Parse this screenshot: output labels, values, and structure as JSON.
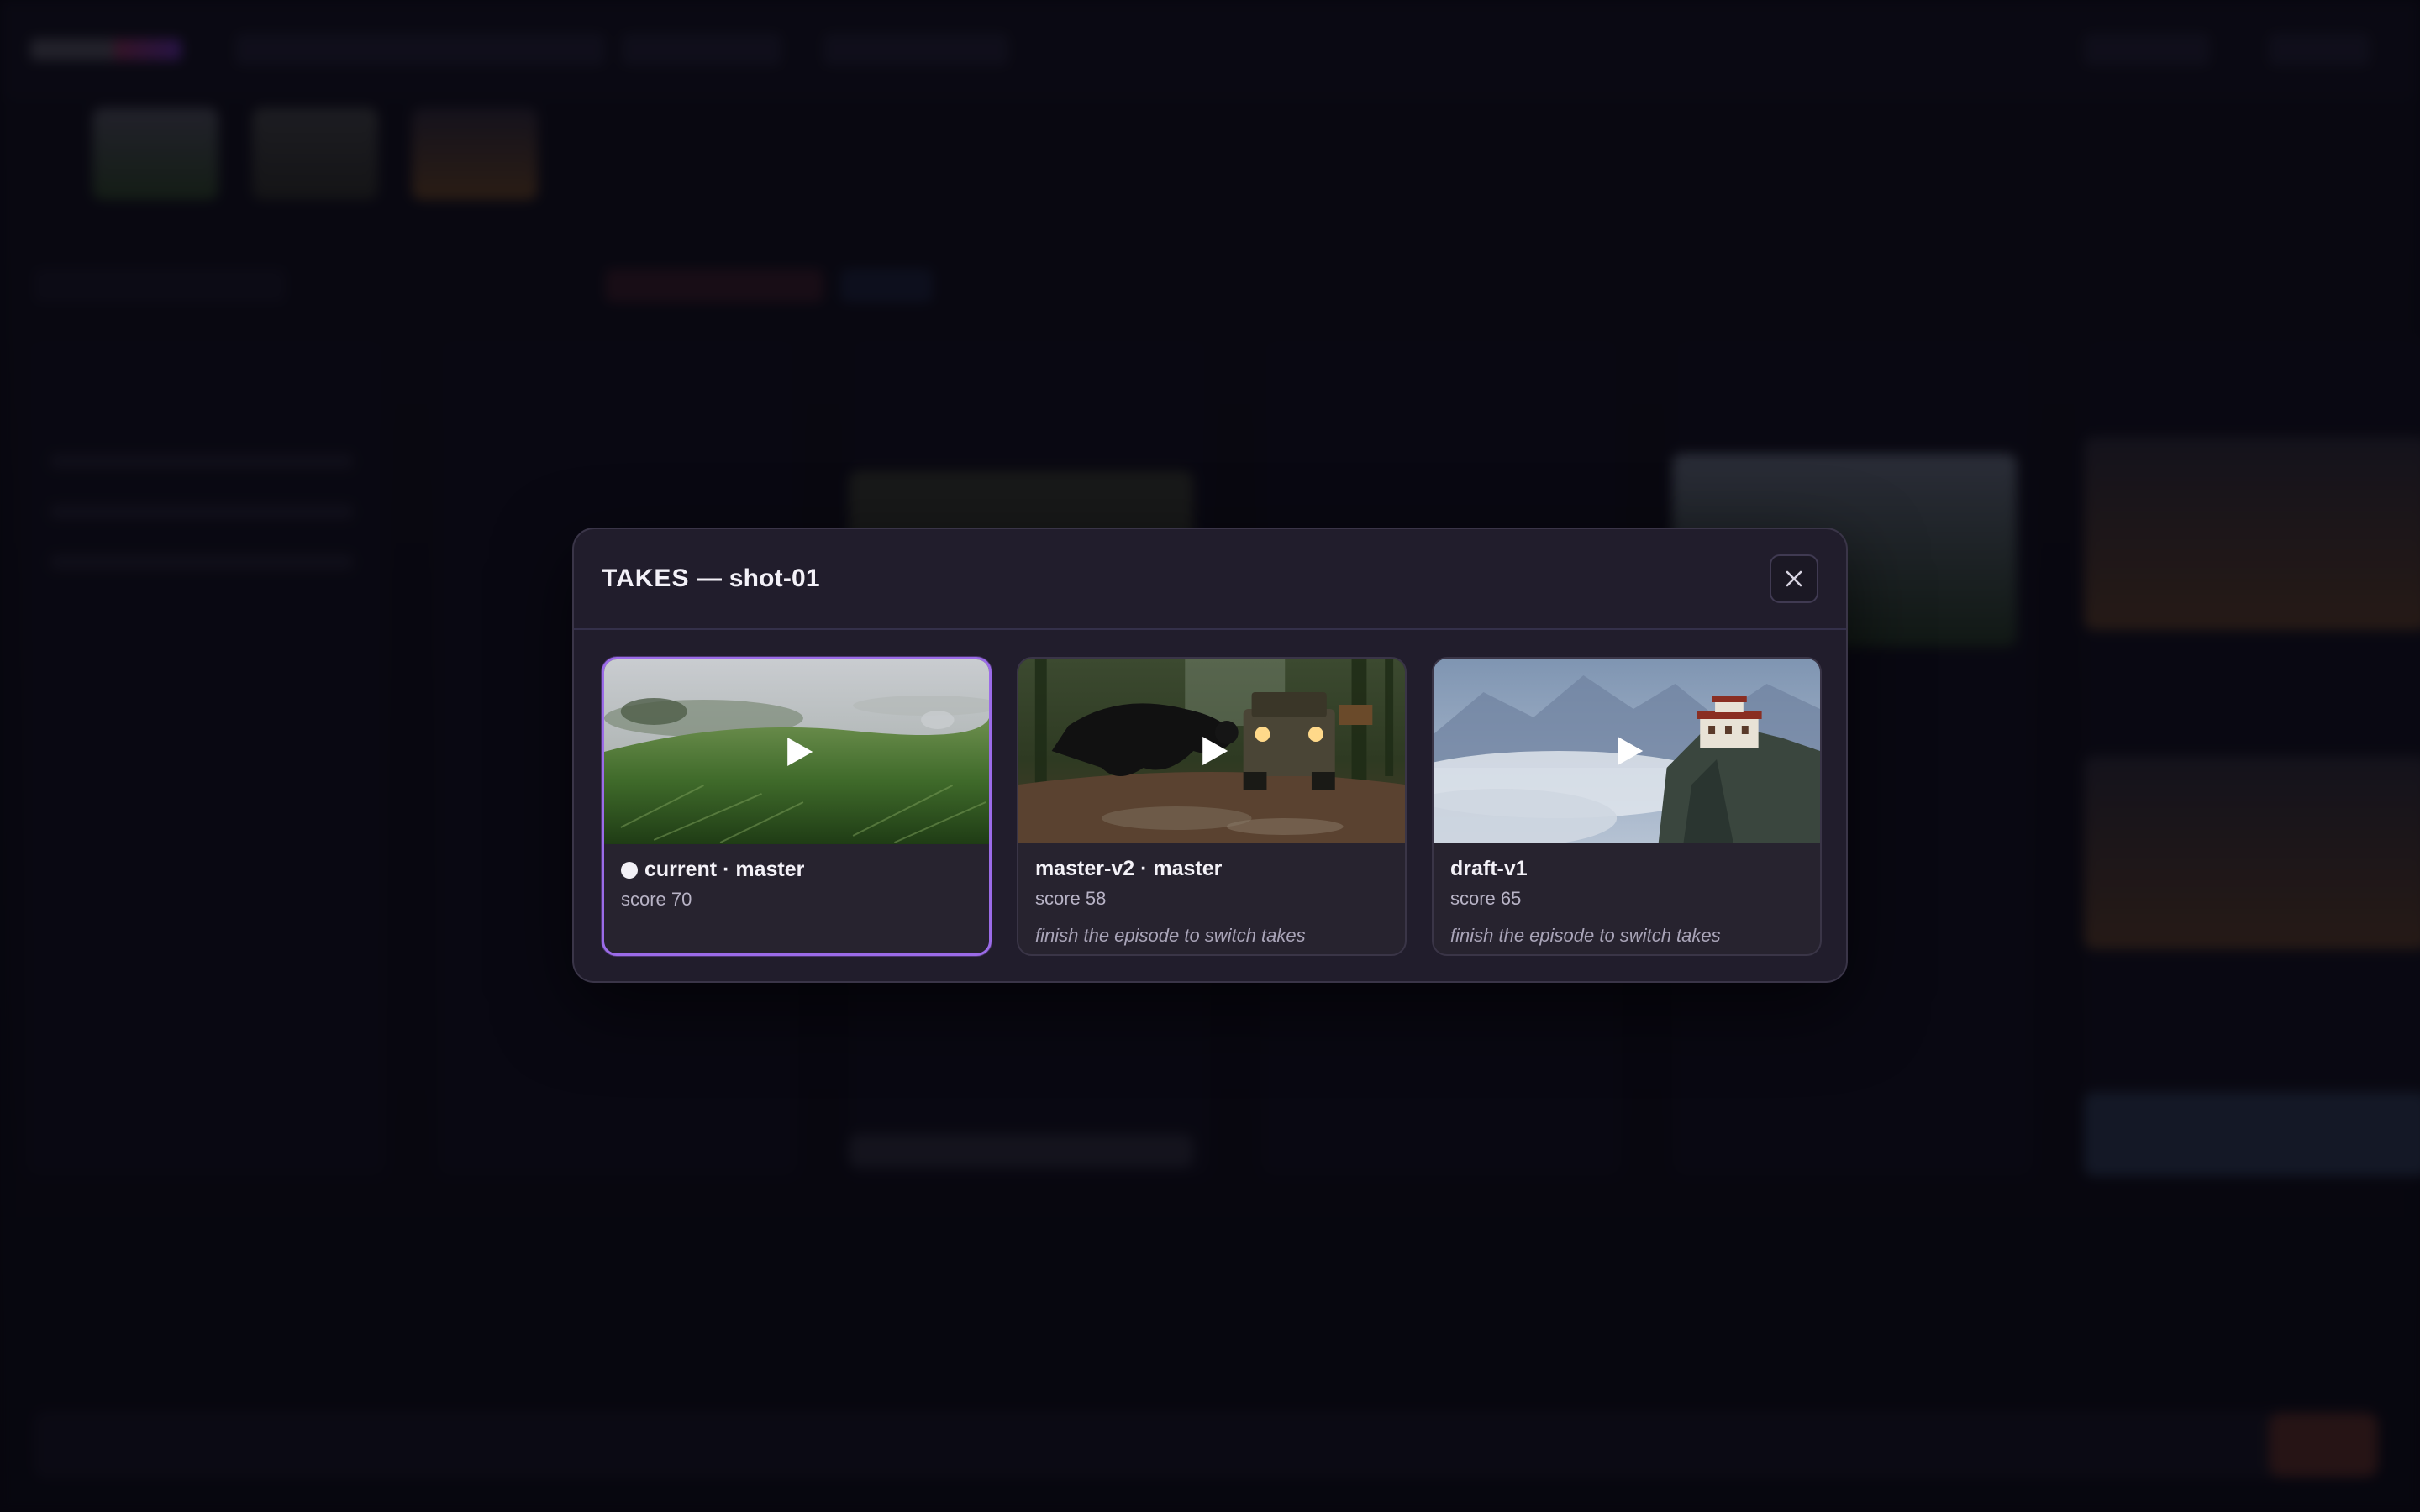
{
  "modal": {
    "title_prefix": "TAKES",
    "title_suffix": " — shot-01",
    "close_icon": "close-icon"
  },
  "takes": [
    {
      "name": "current · master",
      "score": "score 70",
      "hint": "",
      "selected": true,
      "scene": "grass-hillside"
    },
    {
      "name": "master-v2 · master",
      "score": "score 58",
      "hint": "finish the episode to switch takes",
      "selected": false,
      "scene": "panther-jeep-jungle"
    },
    {
      "name": "draft-v1",
      "score": "score 65",
      "hint": "finish the episode to switch takes",
      "selected": false,
      "scene": "cliff-monastery-clouds"
    }
  ],
  "colors": {
    "accent": "#9b6be8",
    "modal_bg": "#211d2c",
    "card_bg": "#27232f",
    "backdrop": "#0b0a14"
  }
}
